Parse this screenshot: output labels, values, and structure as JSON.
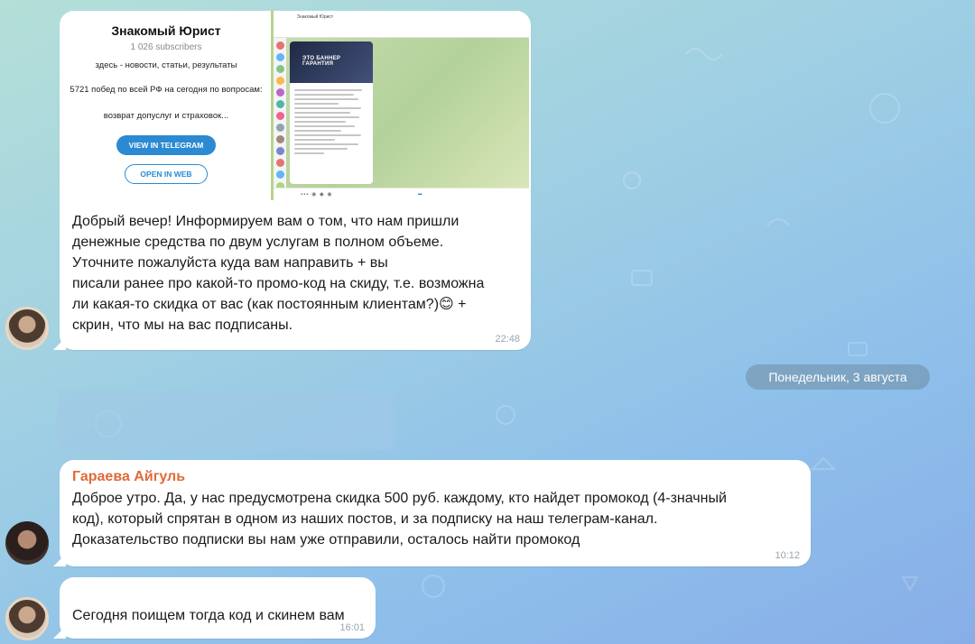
{
  "shared_card": {
    "channel_title": "Знакомый Юрист",
    "subscribers": "1 026 subscribers",
    "description_1": "здесь - новости, статьи, результаты",
    "description_2": "5721 побед по всей РФ на сегодня по вопросам:",
    "description_3": "возврат допуслуг и страховок...",
    "view_in_telegram": "VIEW IN TELEGRAM",
    "open_in_web": "OPEN IN WEB",
    "mini_post_banner": "ЭТО БАННЕР ГАРАНТИЯ"
  },
  "messages": [
    {
      "text": "Добрый вечер! Информируем вам о том, что нам пришли\nденежные средства по двум услугам в полном объеме.\nУточните пожалуйста куда вам направить                       + вы\nписали ранее про какой-то промо-код на скиду, т.е. возможна\nли какая-то скидка от вас (как постоянным клиентам?)😊  +\nскрин, что мы на вас подписаны.",
      "time": "22:48"
    },
    {
      "sender": "Гараева Айгуль",
      "text": "Доброе утро. Да, у нас предусмотрена скидка 500 руб. каждому, кто найдет промокод (4-значный\nкод), который спрятан в одном из наших постов, и за подписку на наш телеграм-канал.\nДоказательство подписки вы нам уже отправили, осталось найти промокод",
      "time": "10:12"
    },
    {
      "text": "Сегодня поищем тогда код и скинем вам",
      "time": "16:01"
    }
  ],
  "date_separator": "Понедельник, 3 августа",
  "colors": {
    "sender_name": "#e06a3b",
    "accent_blue": "#2b8ad2"
  }
}
